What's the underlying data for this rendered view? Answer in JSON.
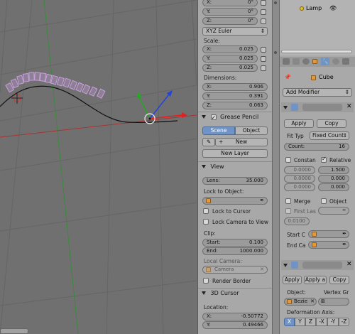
{
  "rotation": {
    "x_label": "X:",
    "x_value": "0°",
    "y_label": "Y:",
    "y_value": "0°",
    "z_label": "Z:",
    "z_value": "0°",
    "mode": "XYZ Euler"
  },
  "scale": {
    "title": "Scale:",
    "x_label": "X:",
    "x_value": "0.025",
    "y_label": "Y:",
    "y_value": "0.025",
    "z_label": "Z:",
    "z_value": "0.025"
  },
  "dimensions": {
    "title": "Dimensions:",
    "x_label": "X:",
    "x_value": "0.906",
    "y_label": "Y:",
    "y_value": "0.391",
    "z_label": "Z:",
    "z_value": "0.063"
  },
  "grease_pencil": {
    "title": "Grease Pencil",
    "tab_scene": "Scene",
    "tab_object": "Object",
    "new_label": "New",
    "new_layer_label": "New Layer"
  },
  "view": {
    "title": "View",
    "lens_label": "Lens:",
    "lens_value": "35.000",
    "lock_object_label": "Lock to Object:",
    "lock_cursor_label": "Lock to Cursor",
    "lock_camera_label": "Lock Camera to View",
    "clip_label": "Clip:",
    "start_label": "Start:",
    "start_value": "0.100",
    "end_label": "End:",
    "end_value": "1000.000",
    "local_camera_label": "Local Camera:",
    "camera_placeholder": "Camera",
    "render_border_label": "Render Border"
  },
  "cursor_3d": {
    "title": "3D Cursor",
    "location_label": "Location:",
    "x_label": "X:",
    "x_value": "-0.50772",
    "y_label": "Y:",
    "y_value": "0.49466"
  },
  "outliner": {
    "lamp_label": "Lamp"
  },
  "properties": {
    "object_name": "Cube",
    "add_modifier": "Add Modifier",
    "array": {
      "apply": "Apply",
      "copy": "Copy",
      "fit_type_label": "Fit Typ",
      "fit_type_value": "Fixed Count",
      "count_label": "Count:",
      "count_value": "16",
      "constant_label": "Constan",
      "relative_label": "Relative",
      "const_x": "0.0000",
      "const_y": "0.0000",
      "const_z": "0.0000",
      "rel_x": "1.500",
      "rel_y": "0.000",
      "rel_z": "0.000",
      "merge_label": "Merge",
      "object_label": "Object",
      "first_last_label": "First Las",
      "merge_distance": "0.0100",
      "start_cap_label": "Start C",
      "end_cap_label": "End Ca"
    },
    "curve": {
      "apply": "Apply",
      "apply_as": "Apply a",
      "copy": "Copy",
      "object_label": "Object:",
      "vertex_group_label": "Vertex Gr",
      "object_value": "Bezie",
      "deform_axis_label": "Deformation Axis:",
      "axes": [
        "X",
        "Y",
        "Z",
        "-X",
        "-Y",
        "-Z"
      ]
    }
  },
  "colors": {
    "viewport_bg": "#707070",
    "grid_line": "#666666",
    "x_axis": "#c0392b",
    "y_axis": "#3a8a3a",
    "blue_selected": "#6f93c6",
    "object_orange": "#e49a3a"
  },
  "icons": [
    "lock-icon",
    "cube-icon",
    "eyedropper-icon",
    "pencil-icon",
    "plus-icon",
    "wrench-icon",
    "pin-icon",
    "close-icon",
    "eye-icon",
    "lamp-icon"
  ]
}
